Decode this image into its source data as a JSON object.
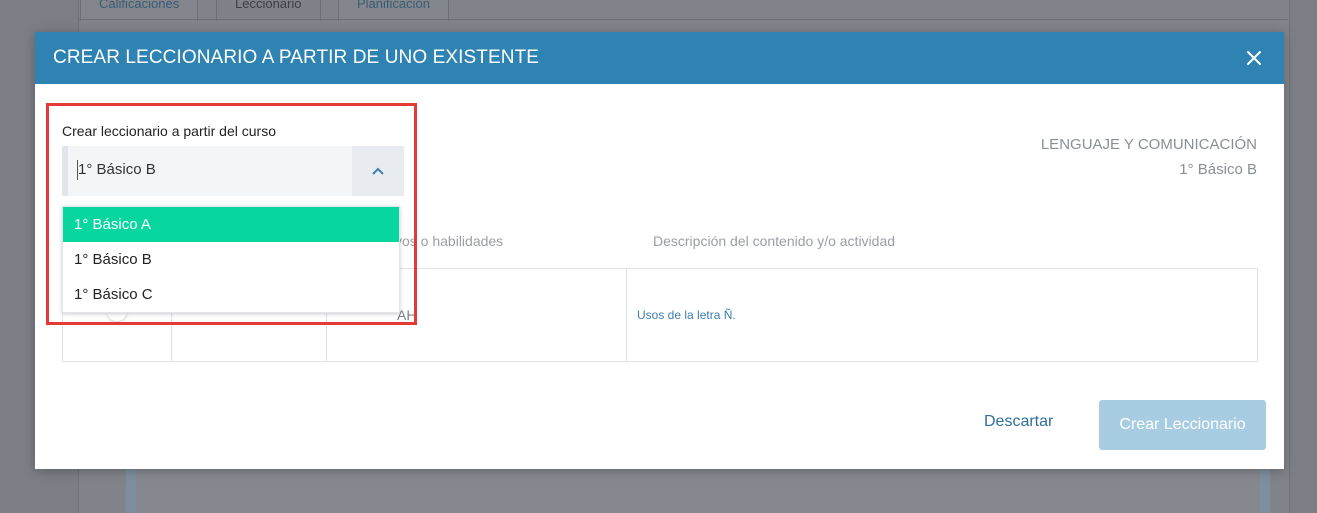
{
  "background": {
    "tabs": [
      "Calificaciones",
      "Leccionario",
      "Planificación"
    ]
  },
  "modal": {
    "title": "CREAR LECCIONARIO A PARTIR DE UNO EXISTENTE",
    "close_icon": "close-icon",
    "field_label": "Crear leccionario a partir del curso",
    "select_value": "1° Básico B",
    "dropdown_options": [
      "1° Básico A",
      "1° Básico B",
      "1° Básico C"
    ],
    "highlighted_option": "1° Básico A",
    "course_info": {
      "subject": "LENGUAJE Y COMUNICACIÓN",
      "level": "1° Básico B"
    },
    "table": {
      "header_partial": "vos o habilidades",
      "header_description": "Descripción del contenido y/o actividad",
      "row_partial": "AH",
      "row_description": "Usos de la letra Ñ."
    },
    "discard_label": "Descartar",
    "create_label": "Crear Leccionario"
  },
  "colors": {
    "header_blue": "#2f83b3",
    "selected_green": "#07d6a0",
    "highlight_red": "#e53935",
    "create_button_disabled": "#a8cde3"
  }
}
